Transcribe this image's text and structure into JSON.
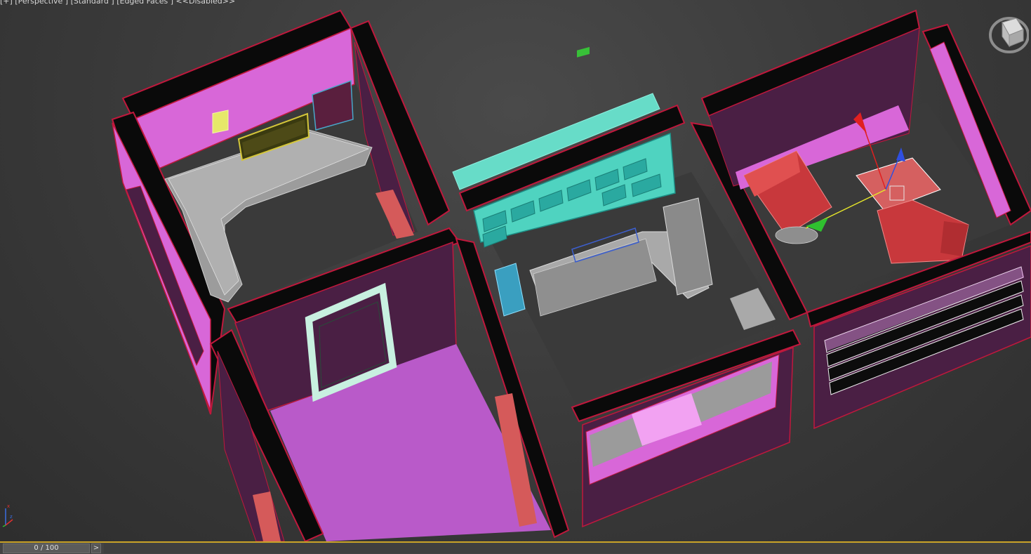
{
  "viewport": {
    "label": "[+] [Perspective ] [Standard ] [Edged Faces ]  <<Disabled>>"
  },
  "viewcube": {
    "icon": "viewcube-icon"
  },
  "axis_tripod": {
    "icon": "axis-tripod-icon",
    "x_label": "x",
    "z_label": "z"
  },
  "gizmo": {
    "icon": "move-gizmo-icon"
  },
  "timeline": {
    "frame_display": "0 / 100",
    "next_label": ">",
    "current_frame": 0,
    "total_frames": 100
  },
  "colors": {
    "viewport_bg": "#3c3c3c",
    "wall_pink": "#d66ad6",
    "wall_dark": "#4a1f44",
    "edge_red": "#c0183c",
    "floor_pink": "#b95ac9",
    "shelf_cyan": "#67dcc8",
    "furniture_gray": "#a9a9a9",
    "chair_red": "#c8383c",
    "timeline_accent": "#c9a227"
  }
}
